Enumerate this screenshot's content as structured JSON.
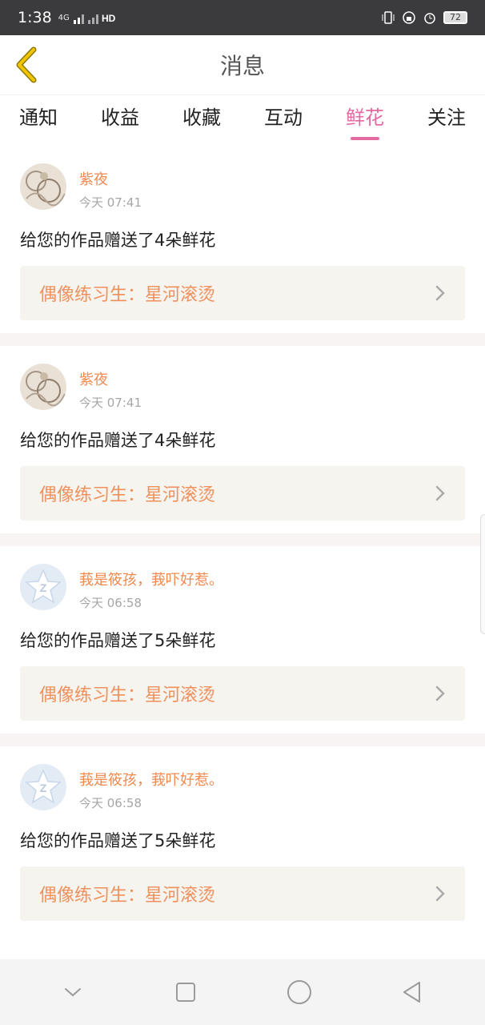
{
  "status_bar": {
    "time": "1:38",
    "network": "4G",
    "battery": "72"
  },
  "header": {
    "title": "消息"
  },
  "tabs": [
    {
      "label": "通知"
    },
    {
      "label": "收益"
    },
    {
      "label": "收藏"
    },
    {
      "label": "互动"
    },
    {
      "label": "鲜花"
    },
    {
      "label": "关注"
    }
  ],
  "active_tab": "鲜花",
  "messages": [
    {
      "user": "紫夜",
      "time": "今天 07:41",
      "text": "给您的作品赠送了4朵鲜花",
      "work": "偶像练习生：星河滚烫",
      "avatar": "lace-avatar"
    },
    {
      "user": "紫夜",
      "time": "今天 07:41",
      "text": "给您的作品赠送了4朵鲜花",
      "work": "偶像练习生：星河滚烫",
      "avatar": "lace-avatar"
    },
    {
      "user": "莪是筱孩，莪吓好惹。",
      "time": "今天 06:58",
      "text": "给您的作品赠送了5朵鲜花",
      "work": "偶像练习生：星河滚烫",
      "avatar": "default-star-avatar"
    },
    {
      "user": "莪是筱孩，莪吓好惹。",
      "time": "今天 06:58",
      "text": "给您的作品赠送了5朵鲜花",
      "work": "偶像练习生：星河滚烫",
      "avatar": "default-star-avatar"
    }
  ],
  "colors": {
    "accent": "#e46aa1",
    "username": "#f08a4f",
    "work_link": "#f0905d",
    "back_icon": "#f2c400"
  },
  "bottom_nav": [
    "chevron-down-icon",
    "square-icon",
    "circle-icon",
    "triangle-back-icon"
  ]
}
